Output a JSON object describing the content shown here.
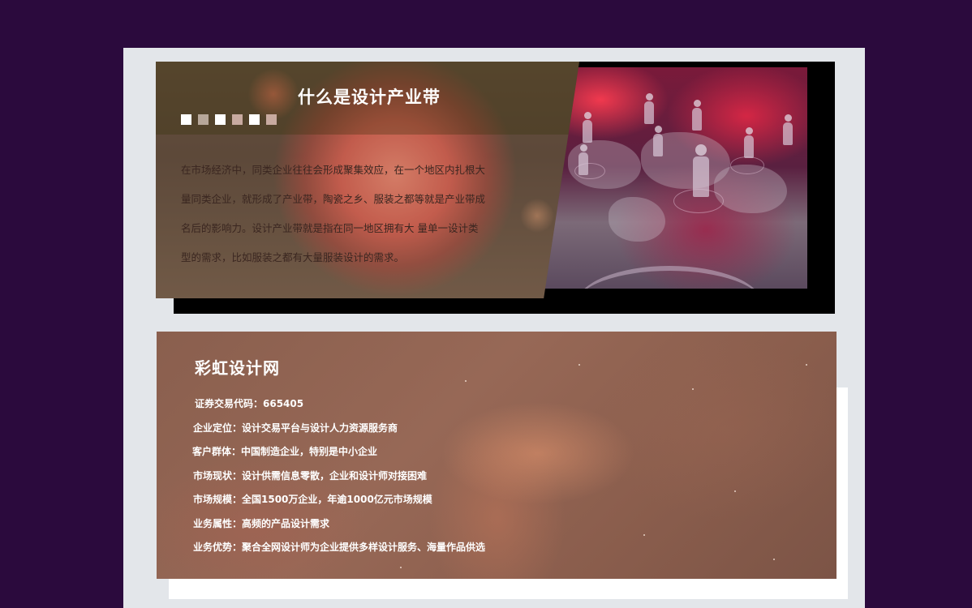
{
  "top_section": {
    "title": "什么是设计产业带",
    "dots": [
      "#ffffff",
      "#b7a79a",
      "#ffffff",
      "#c8aaa0",
      "#ffffff",
      "#c8aaa0"
    ],
    "paragraph_lines": [
      "在市场经济中，同类企业往往会形成聚集效应，在一个地区内扎根大",
      "量同类企业，就形成了产业带，陶瓷之乡、服装之都等就是产业带成",
      "名后的影响力。设计产业带就是指在同一地区拥有大 量单一设计类",
      "型的需求，比如服装之都有大量服装设计的需求。"
    ]
  },
  "bottom_section": {
    "title": "彩虹设计网",
    "info_lines": [
      "证券交易代码：665405",
      "企业定位：设计交易平台与设计人力资源服务商",
      "客户群体：中国制造企业，特别是中小企业",
      "市场现状：设计供需信息零散，企业和设计师对接困难",
      "市场规模：全国1500万企业，年逾1000亿元市场规模",
      "业务属性：高频的产品设计需求",
      "业务优势：聚合全网设计师为企业提供多样设计服务、海量作品供选"
    ]
  },
  "colors": {
    "page_background": "#2b0a3d",
    "content_background": "#e3e6ea"
  }
}
